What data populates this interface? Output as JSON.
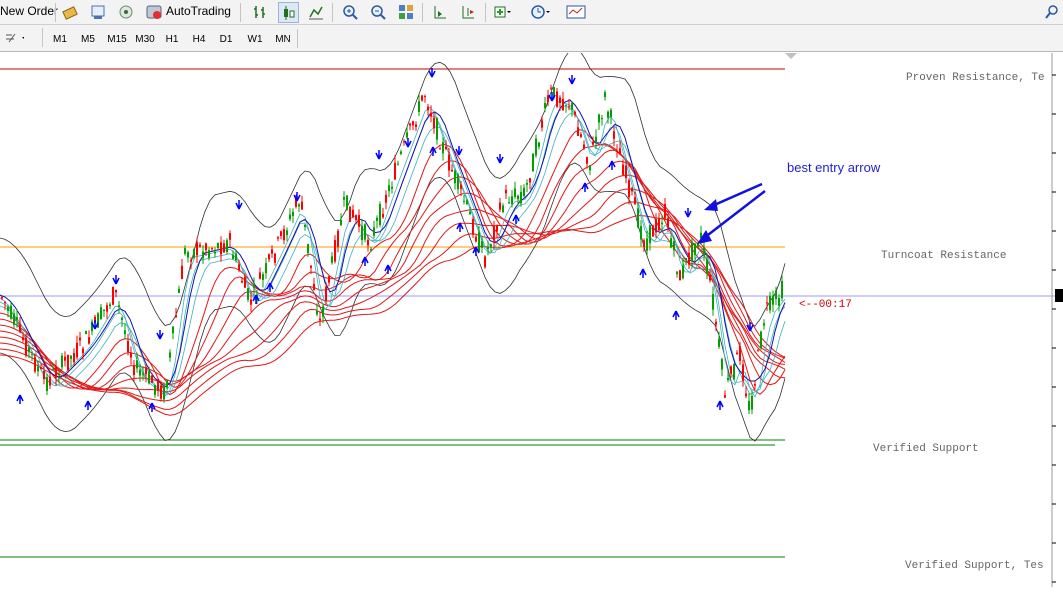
{
  "toolbar": {
    "new_order_label": "New Order",
    "autotrading_label": "AutoTrading"
  },
  "timeframes": [
    "M1",
    "M5",
    "M15",
    "M30",
    "H1",
    "H4",
    "D1",
    "W1",
    "MN"
  ],
  "chart": {
    "annotation": "best entry arrow",
    "countdown": "<--00:17",
    "levels": {
      "proven_resistance": "Proven Resistance, Te",
      "turncoat_resistance": "Turncoat Resistance",
      "verified_support": "Verified Support",
      "verified_support_2": "Verified Support, Tes"
    },
    "colors": {
      "bull": "#00a000",
      "bear": "#ff0000",
      "arrow": "#0000ff",
      "band": "#303030",
      "resistance_line": "#c00000",
      "turncoat_line": "#ff9900",
      "support_line": "#008000",
      "bid_line": "#9999ff"
    }
  }
}
